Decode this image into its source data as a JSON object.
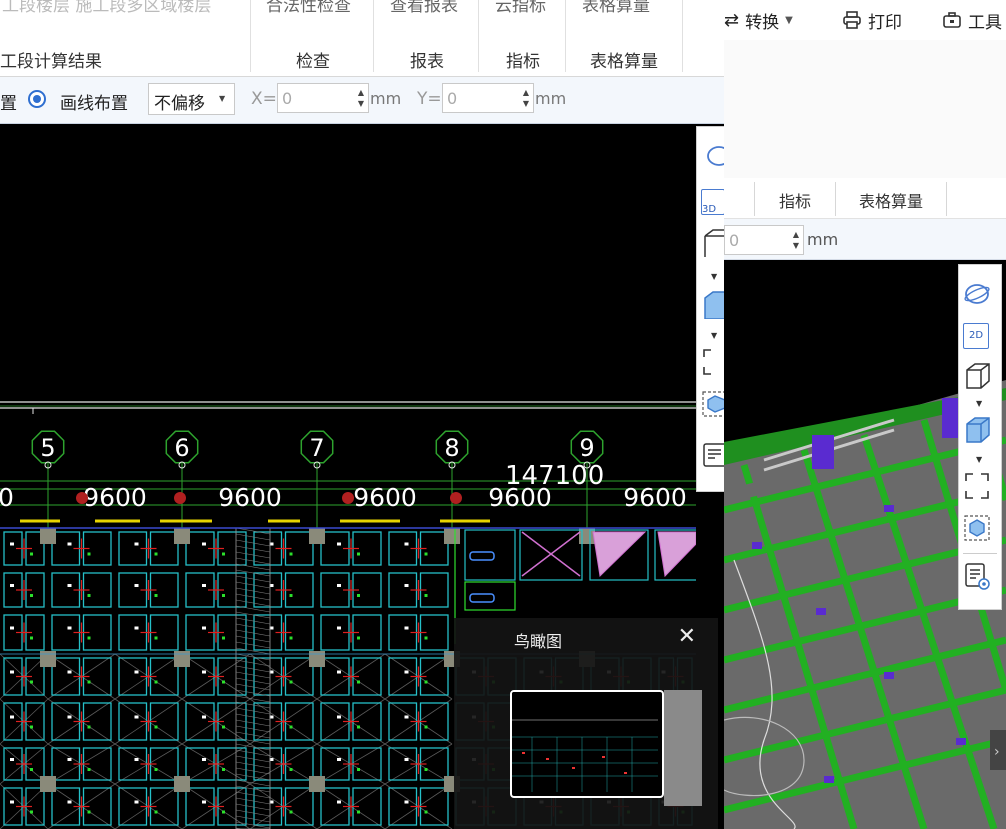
{
  "back_window": {
    "toolbar": {
      "convert_label": "转换",
      "print_label": "打印",
      "tools_label": "工具"
    },
    "ribbon": {
      "indicators_label": "指标",
      "table_qty_label": "表格算量"
    },
    "options": {
      "y_value": "0",
      "unit": "mm"
    },
    "view_tools": {
      "view_2d_label": "2D"
    }
  },
  "front_window": {
    "ribbon": {
      "top_left_cut": "工段楼层  施工段多区域楼层",
      "top_mid_cut": "合法性检查",
      "top_report_cut": "查看报表",
      "top_indicator_cut": "云指标",
      "top_table_cut": "表格算量",
      "group_result_label": "工段计算结果",
      "check_label": "检查",
      "report_label": "报表",
      "indicators_label": "指标",
      "table_qty_label": "表格算量"
    },
    "options": {
      "cut_label": "置",
      "line_layout_label": "画线布置",
      "offset_select": "不偏移",
      "x_label": "X=",
      "x_value": "0",
      "y_label": "Y=",
      "y_value": "0",
      "unit": "mm"
    },
    "view_tools": {
      "view_3d_label": "3D"
    },
    "drawing": {
      "axis_labels": [
        "5",
        "6",
        "7",
        "8",
        "9"
      ],
      "total_dimension": "147100",
      "span_dimensions": [
        "0",
        "9600",
        "9600",
        "9600",
        "9600",
        "9600"
      ]
    },
    "aerial_view": {
      "title": "鸟瞰图",
      "close_symbol": "✕"
    }
  }
}
